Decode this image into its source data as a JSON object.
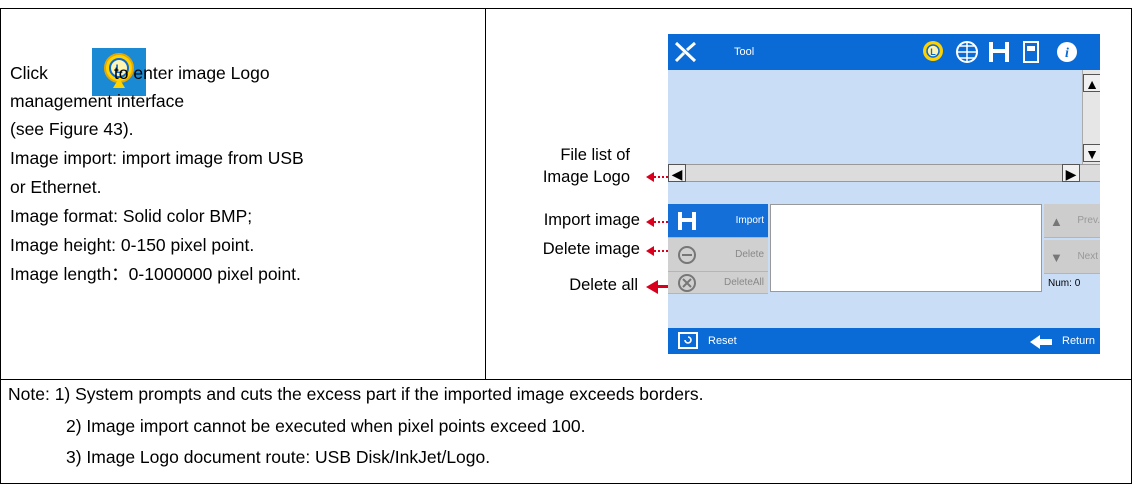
{
  "page": {
    "title_partial": "... Logo management",
    "left": {
      "lines": [
        "to enter image Logo",
        "management interface",
        "(see Figure 43).",
        "Image import: import image from USB",
        "or Ethernet.",
        "Image format: Solid color BMP;",
        "Image height: 0-150 pixel point.",
        "Image length：0-1000000 pixel point."
      ],
      "click_label": "Click"
    },
    "notes": [
      "Note: 1) System prompts and cuts the excess part if the imported image exceeds borders.",
      "2) Image import cannot be executed when pixel points exceed 100.",
      "3) Image Logo document route: USB Disk/InkJet/Logo."
    ]
  },
  "device": {
    "topbar": {
      "tool_label": "Tool",
      "icons": [
        "tool-icon",
        "logo-icon",
        "globe-icon",
        "save-icon",
        "document-icon",
        "info-icon"
      ]
    },
    "buttons": [
      {
        "label": "Import",
        "icon": "save-icon"
      },
      {
        "label": "Delete",
        "icon": "minus-circle-icon"
      },
      {
        "label": "DeleteAll",
        "icon": "x-circle-icon"
      }
    ],
    "nav": {
      "prev_label": "Prev.",
      "next_label": "Next",
      "num_label": "Num:",
      "num_value": "0"
    },
    "bottombar": {
      "reset_label": "Reset",
      "return_label": "Return"
    }
  },
  "annotations": {
    "file_list": "File list of\nImage Logo",
    "file_list_line1": "File list of",
    "file_list_line2": "Image Logo",
    "import_image": "Import image",
    "delete_image": "Delete image",
    "delete_all": "Delete all"
  },
  "colors": {
    "accent_blue": "#0a6ad6",
    "annotation_red": "#d8001d",
    "screen_bg": "#c9ddf7"
  }
}
